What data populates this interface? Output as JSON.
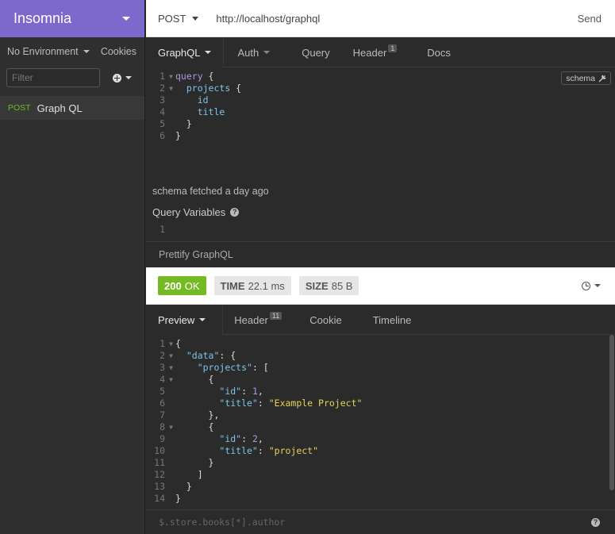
{
  "sidebar": {
    "app_name": "Insomnia",
    "environment": "No Environment",
    "cookies_label": "Cookies",
    "filter_placeholder": "Filter",
    "requests": [
      {
        "method": "POST",
        "name": "Graph QL"
      }
    ]
  },
  "url_bar": {
    "method": "POST",
    "url": "http://localhost/graphql",
    "send_label": "Send"
  },
  "request_tabs": [
    {
      "label": "GraphQL",
      "badge": ""
    },
    {
      "label": "Auth",
      "badge": ""
    },
    {
      "label": "Query",
      "badge": ""
    },
    {
      "label": "Header",
      "badge": "1"
    },
    {
      "label": "Docs",
      "badge": ""
    }
  ],
  "query_editor": {
    "schema_button": "schema",
    "lines": [
      "1",
      "2",
      "3",
      "4",
      "5",
      "6"
    ],
    "tokens": {
      "query_kw": "query",
      "projects": "projects",
      "id": "id",
      "title": "title"
    }
  },
  "schema_status": "schema fetched a day ago",
  "query_variables": {
    "label": "Query Variables",
    "line": "1"
  },
  "prettify_label": "Prettify GraphQL",
  "response": {
    "status_code": "200",
    "status_text": "OK",
    "time_label": "TIME",
    "time_value": "22.1 ms",
    "size_label": "SIZE",
    "size_value": "85 B"
  },
  "response_tabs": [
    {
      "label": "Preview",
      "badge": ""
    },
    {
      "label": "Header",
      "badge": "11"
    },
    {
      "label": "Cookie",
      "badge": ""
    },
    {
      "label": "Timeline",
      "badge": ""
    }
  ],
  "response_body": {
    "lines": [
      "1",
      "2",
      "3",
      "4",
      "5",
      "6",
      "7",
      "8",
      "9",
      "10",
      "11",
      "12",
      "13",
      "14"
    ],
    "keys": {
      "data": "\"data\"",
      "projects": "\"projects\"",
      "id": "\"id\"",
      "title": "\"title\""
    },
    "values": {
      "id1": "1",
      "title1": "\"Example Project\"",
      "id2": "2",
      "title2": "\"project\""
    }
  },
  "response_filter_placeholder": "$.store.books[*].author",
  "colors": {
    "brand": "#7d69cb",
    "success": "#75ba24"
  }
}
